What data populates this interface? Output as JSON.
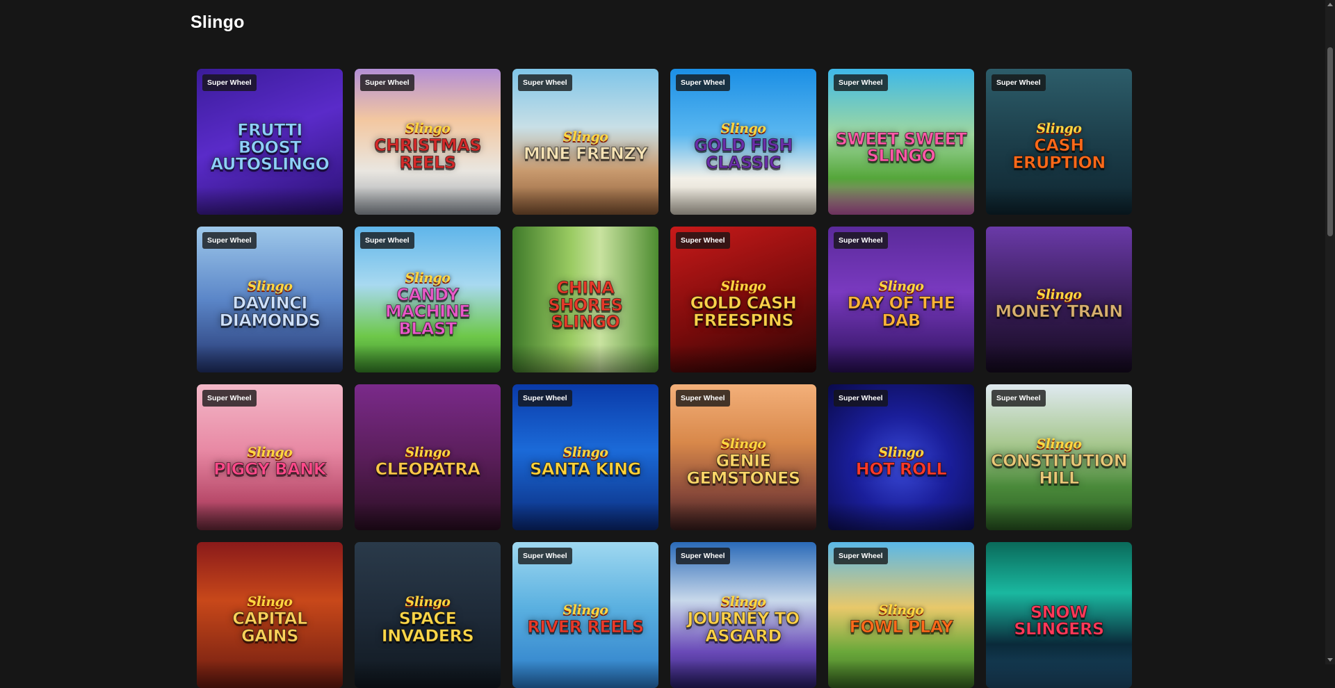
{
  "page": {
    "title": "Slingo"
  },
  "badge_text": "Super Wheel",
  "games": [
    {
      "sub": "",
      "main": "Frutti Boost Autoslingo",
      "badge": true,
      "bg": "linear-gradient(160deg,#3b1c9a 0%,#5a2bc9 45%,#2a1070 100%)",
      "color": "#8fd0ff"
    },
    {
      "sub": "Slingo",
      "main": "Christmas Reels",
      "badge": true,
      "bg": "linear-gradient(180deg,#b38fd6 0%,#f3c7a0 35%,#e9e6e0 70%,#9aa0a8 100%)",
      "color": "#d42a2a"
    },
    {
      "sub": "Slingo",
      "main": "Mine Frenzy",
      "badge": true,
      "bg": "linear-gradient(180deg,#7fc5e8 0%,#c8dfe6 40%,#c89a6e 70%,#8a5a36 100%)",
      "color": "#f6e3b5"
    },
    {
      "sub": "Slingo",
      "main": "Gold Fish Classic",
      "badge": true,
      "bg": "linear-gradient(180deg,#1b8fe5 0%,#5ab7f0 45%,#f3f0e8 75%,#d6cfc0 100%)",
      "color": "#6a2fa8"
    },
    {
      "sub": "",
      "main": "Sweet Sweet Slingo",
      "badge": true,
      "bg": "linear-gradient(180deg,#3eb8e8 0%,#9fd8a0 45%,#55a63a 75%,#c45aa8 100%)",
      "color": "#ff5aa8"
    },
    {
      "sub": "Slingo",
      "main": "Cash Eruption",
      "badge": true,
      "bg": "linear-gradient(180deg,#2d5d6a 0%,#1c3e4a 50%,#0e2530 100%)",
      "color": "#ff6a1a"
    },
    {
      "sub": "Slingo",
      "main": "DaVinci Diamonds",
      "badge": true,
      "bg": "linear-gradient(180deg,#9ec8ea 0%,#5b86c8 50%,#23346e 100%)",
      "color": "#cfe2ff"
    },
    {
      "sub": "Slingo",
      "main": "Candy Machine Blast",
      "badge": true,
      "bg": "linear-gradient(180deg,#5fb5ea 0%,#a8d9f0 40%,#6ec84a 75%,#3a8a2a 100%)",
      "color": "#e85ac8"
    },
    {
      "sub": "",
      "main": "China Shores Slingo",
      "badge": false,
      "bg": "linear-gradient(90deg,#3f7a2a 0%,#9acb62 40%,#c9e3a0 60%,#4d8c30 100%)",
      "color": "#e63a2a"
    },
    {
      "sub": "Slingo",
      "main": "Gold Cash Freespins",
      "badge": true,
      "bg": "linear-gradient(160deg,#c81a1a 0%,#7a0b0b 55%,#2a0404 100%)",
      "color": "#ffd24a"
    },
    {
      "sub": "Slingo",
      "main": "Day of the Dab",
      "badge": true,
      "bg": "linear-gradient(180deg,#5a2a9a 0%,#7a3ac0 45%,#2a1058 100%)",
      "color": "#ffb43a"
    },
    {
      "sub": "Slingo",
      "main": "Money Train",
      "badge": false,
      "bg": "linear-gradient(180deg,#6a3aa8 0%,#3a1e5a 50%,#150a20 100%)",
      "color": "#d9b070"
    },
    {
      "sub": "Slingo",
      "main": "Piggy Bank",
      "badge": true,
      "bg": "linear-gradient(180deg,#f3b8c8 0%,#e889a4 45%,#b84a6a 80%,#6a2a3a 100%)",
      "color": "#ff4a8a"
    },
    {
      "sub": "Slingo",
      "main": "Cleopatra",
      "badge": false,
      "bg": "linear-gradient(180deg,#7a2a8a 0%,#5a1e5a 50%,#2a0e22 100%)",
      "color": "#ffc84a"
    },
    {
      "sub": "Slingo",
      "main": "Santa King",
      "badge": true,
      "bg": "linear-gradient(180deg,#0a3aa8 0%,#1b6ad8 45%,#0a2a7a 100%)",
      "color": "#ffd23a"
    },
    {
      "sub": "Slingo",
      "main": "Genie Gemstones",
      "badge": true,
      "bg": "linear-gradient(180deg,#f3b07a 0%,#d8884a 40%,#8a4a3a 75%,#3a1e1e 100%)",
      "color": "#ffd86a"
    },
    {
      "sub": "Slingo",
      "main": "Hot Roll",
      "badge": true,
      "bg": "radial-gradient(circle at 50% 55%,#3a4ad8 0%,#1a1e9a 45%,#0a0a4a 100%)",
      "color": "#ff3a2a"
    },
    {
      "sub": "Slingo",
      "main": "Constitution Hill",
      "badge": true,
      "bg": "linear-gradient(180deg,#dfe9f0 0%,#a8c890 40%,#4a8a3a 70%,#2a5a22 100%)",
      "color": "#e8c878"
    },
    {
      "sub": "Slingo",
      "main": "Capital Gains",
      "badge": false,
      "bg": "linear-gradient(180deg,#8a1a1a 0%,#c8481a 40%,#6a1a10 100%)",
      "color": "#ffd25a"
    },
    {
      "sub": "Slingo",
      "main": "Space Invaders",
      "badge": false,
      "bg": "linear-gradient(180deg,#2a3a4a 0%,#1e2a38 50%,#101820 100%)",
      "color": "#ffd84a"
    },
    {
      "sub": "Slingo",
      "main": "River Reels",
      "badge": true,
      "bg": "linear-gradient(180deg,#9fd8f0 0%,#5ab0e0 45%,#2a7ac8 100%)",
      "color": "#e83a2a"
    },
    {
      "sub": "Slingo",
      "main": "Journey to Asgard",
      "badge": true,
      "bg": "linear-gradient(180deg,#2a6ab8 0%,#c8d8ea 40%,#6a4ab8 75%,#2a1e6a 100%)",
      "color": "#ffd24a"
    },
    {
      "sub": "Slingo",
      "main": "Fowl Play",
      "badge": true,
      "bg": "linear-gradient(180deg,#5ab8e8 0%,#e8c86a 45%,#6aa83a 75%,#3a6a22 100%)",
      "color": "#ff6a1a"
    },
    {
      "sub": "",
      "main": "Snow Slingers",
      "badge": false,
      "bg": "linear-gradient(180deg,#0a6a5a 0%,#1ab8a0 35%,#0a2a3a 70%,#1e4a6a 100%)",
      "color": "#ff3a5a"
    }
  ]
}
